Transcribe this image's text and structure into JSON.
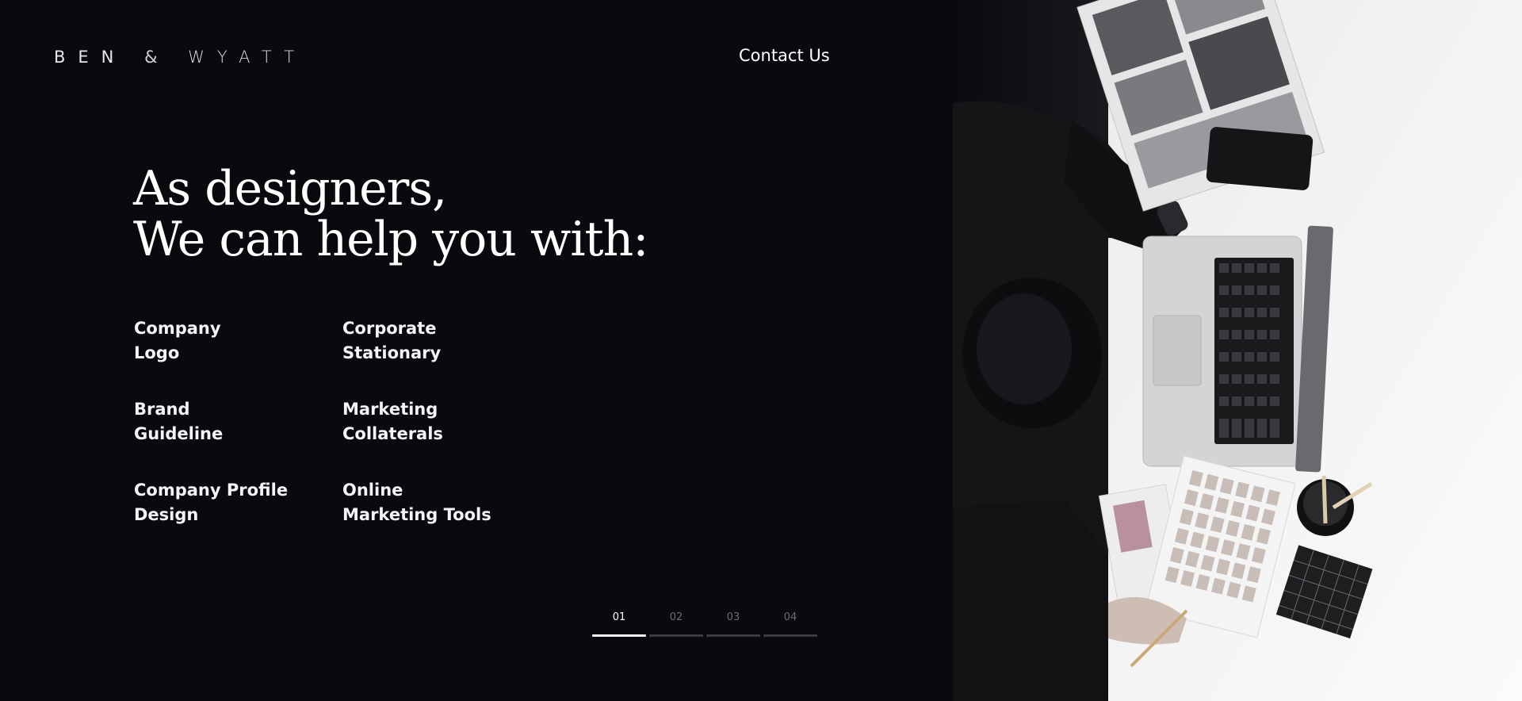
{
  "brand": {
    "name_first": "BEN",
    "ampersand": "&",
    "name_second": "WYATT"
  },
  "nav": {
    "contact_label": "Contact Us"
  },
  "hero": {
    "headline_line1": "As designers,",
    "headline_line2": "We can help you with:"
  },
  "services": [
    {
      "line1": "Company",
      "line2": "Logo"
    },
    {
      "line1": "Corporate",
      "line2": "Stationary"
    },
    {
      "line1": "Brand",
      "line2": "Guideline"
    },
    {
      "line1": "Marketing",
      "line2": "Collaterals"
    },
    {
      "line1": "Company Profile",
      "line2": "Design"
    },
    {
      "line1": "Online",
      "line2": "Marketing Tools"
    }
  ],
  "pager": {
    "active_index": 0,
    "items": [
      {
        "label": "01"
      },
      {
        "label": "02"
      },
      {
        "label": "03"
      },
      {
        "label": "04"
      }
    ]
  },
  "colors": {
    "background": "#09090e",
    "text": "#ffffff",
    "pager_inactive": "#3a3a42",
    "pager_active": "#f4f4f4"
  },
  "photo": {
    "subject": "overhead-desk-laptop-photo"
  }
}
